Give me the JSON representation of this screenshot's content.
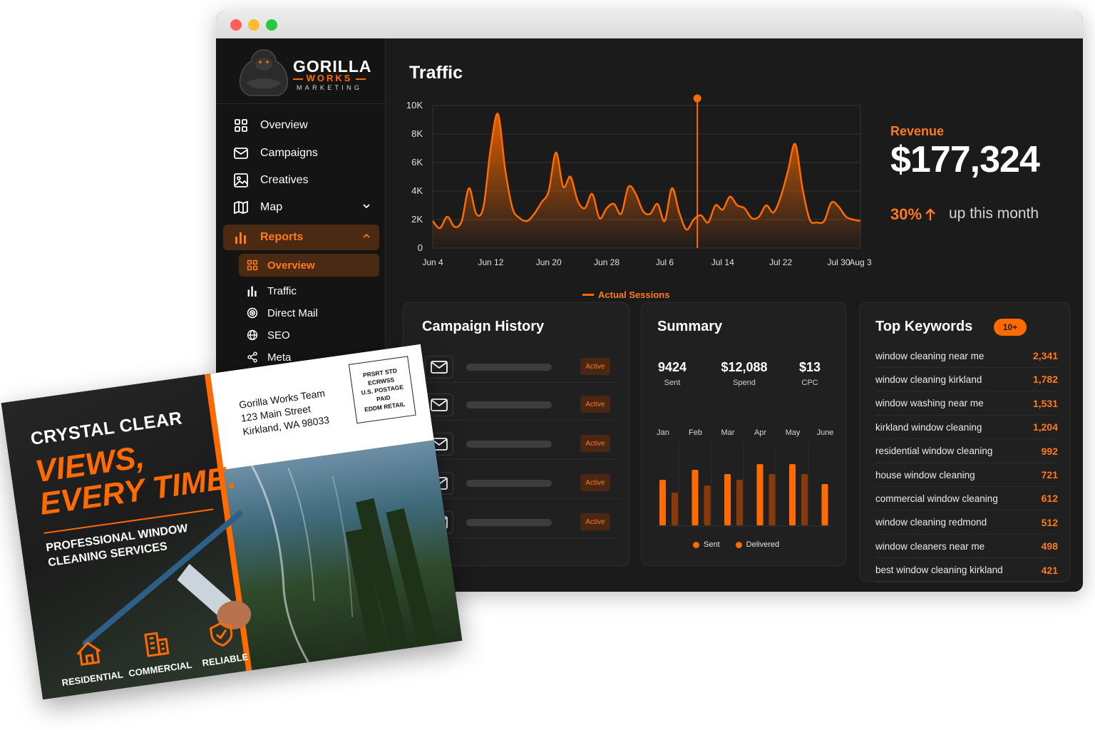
{
  "brand": {
    "name_line1": "GORILLA",
    "name_line2": "WORKS",
    "name_line3": "MARKETING"
  },
  "sidebar": {
    "items": [
      {
        "label": "Overview",
        "icon": "grid-icon"
      },
      {
        "label": "Campaigns",
        "icon": "mail-icon"
      },
      {
        "label": "Creatives",
        "icon": "image-icon"
      },
      {
        "label": "Map",
        "icon": "map-icon"
      },
      {
        "label": "Reports",
        "icon": "bar-chart-icon"
      }
    ],
    "reports_sub": [
      {
        "label": "Overview",
        "icon": "grid-icon"
      },
      {
        "label": "Traffic",
        "icon": "bar-chart-icon"
      },
      {
        "label": "Direct Mail",
        "icon": "target-icon"
      },
      {
        "label": "SEO",
        "icon": "globe-icon"
      },
      {
        "label": "Meta",
        "icon": "share-icon"
      }
    ]
  },
  "traffic": {
    "title": "Traffic",
    "legend": "Actual Sessions"
  },
  "chart_data": [
    {
      "type": "area",
      "title": "Traffic",
      "series": [
        {
          "name": "Actual Sessions",
          "values": [
            1900,
            1400,
            2200,
            1500,
            1900,
            4200,
            2400,
            2900,
            7000,
            9400,
            5500,
            2800,
            2100,
            1900,
            2400,
            3200,
            4000,
            6700,
            4300,
            5000,
            3300,
            2800,
            3800,
            2100,
            2800,
            3100,
            2400,
            4300,
            3800,
            2600,
            2400,
            3100,
            1900,
            4200,
            2500,
            1300,
            2000,
            2300,
            1800,
            3000,
            2700,
            3600,
            3000,
            2800,
            2100,
            2200,
            3000,
            2500,
            3600,
            5400,
            7300,
            4200,
            2000,
            1800,
            1900,
            3200,
            2900,
            2200,
            2000,
            1900
          ]
        }
      ],
      "x_start": "Jun 4",
      "x_end": "Aug 3",
      "x_tick_labels": [
        "Jun 4",
        "Jun 12",
        "Jun 20",
        "Jun 28",
        "Jul 6",
        "Jul 14",
        "Jul 22",
        "Jul 30",
        "Aug 3"
      ],
      "y_tick_labels": [
        "0",
        "2K",
        "4K",
        "6K",
        "8K",
        "10K"
      ],
      "ylim": [
        0,
        10000
      ],
      "marker_label": "Jul 6",
      "grid": true,
      "colors": {
        "line": "#ff6b00",
        "grid": "#333335"
      }
    },
    {
      "type": "bar",
      "categories": [
        "Jan",
        "Feb",
        "Mar",
        "Apr",
        "May",
        "June"
      ],
      "series": [
        {
          "name": "Sent",
          "values": [
            3.2,
            3.9,
            3.6,
            4.3,
            4.3,
            2.9
          ],
          "color": "#ff6b00"
        },
        {
          "name": "Delivered",
          "values": [
            2.3,
            2.8,
            3.2,
            3.6,
            3.6,
            0
          ],
          "color": "#8a3a0a"
        }
      ]
    }
  ],
  "revenue": {
    "label": "Revenue",
    "value": "$177,324",
    "pct": "30%",
    "note": "up this month"
  },
  "campaign_history": {
    "title": "Campaign History",
    "rows": [
      {
        "status": "Active"
      },
      {
        "status": "Active"
      },
      {
        "status": "Active"
      },
      {
        "status": "Active"
      },
      {
        "status": "Active"
      }
    ]
  },
  "summary": {
    "title": "Summary",
    "stats": [
      {
        "value": "9424",
        "label": "Sent"
      },
      {
        "value": "$12,088",
        "label": "Spend"
      },
      {
        "value": "$13",
        "label": "CPC"
      }
    ],
    "legend": [
      {
        "label": "Sent",
        "color": "#ff6b00"
      },
      {
        "label": "Delivered",
        "color": "#ff6b00"
      }
    ]
  },
  "keywords": {
    "title": "Top Keywords",
    "badge": "10+",
    "rows": [
      {
        "term": "window cleaning near me",
        "count": "2,341"
      },
      {
        "term": "window cleaning kirkland",
        "count": "1,782"
      },
      {
        "term": "window washing near me",
        "count": "1,531"
      },
      {
        "term": "kirkland window cleaning",
        "count": "1,204"
      },
      {
        "term": "residential window cleaning",
        "count": "992"
      },
      {
        "term": "house window cleaning",
        "count": "721"
      },
      {
        "term": "commercial window cleaning",
        "count": "612"
      },
      {
        "term": "window cleaning redmond",
        "count": "512"
      },
      {
        "term": "window cleaners near me",
        "count": "498"
      },
      {
        "term": "best window cleaning kirkland",
        "count": "421"
      }
    ]
  },
  "postcard": {
    "headline1": "CRYSTAL CLEAR",
    "headline2": "VIEWS,",
    "headline3": "EVERY TIME.",
    "sub1": "PROFESSIONAL WINDOW",
    "sub2": "CLEANING SERVICES",
    "icons": [
      {
        "label": "RESIDENTIAL"
      },
      {
        "label": "COMMERCIAL"
      },
      {
        "label": "RELIABLE"
      }
    ],
    "address": [
      "Gorilla Works Team",
      "123 Main Street",
      "Kirkland, WA 98033"
    ],
    "stamp": [
      "PRSRT STD",
      "ECRWSS",
      "U.S. POSTAGE",
      "PAID",
      "EDDM RETAIL"
    ]
  },
  "colors": {
    "accent": "#ff6b00",
    "bg": "#1b1b1c",
    "card": "#202021"
  }
}
